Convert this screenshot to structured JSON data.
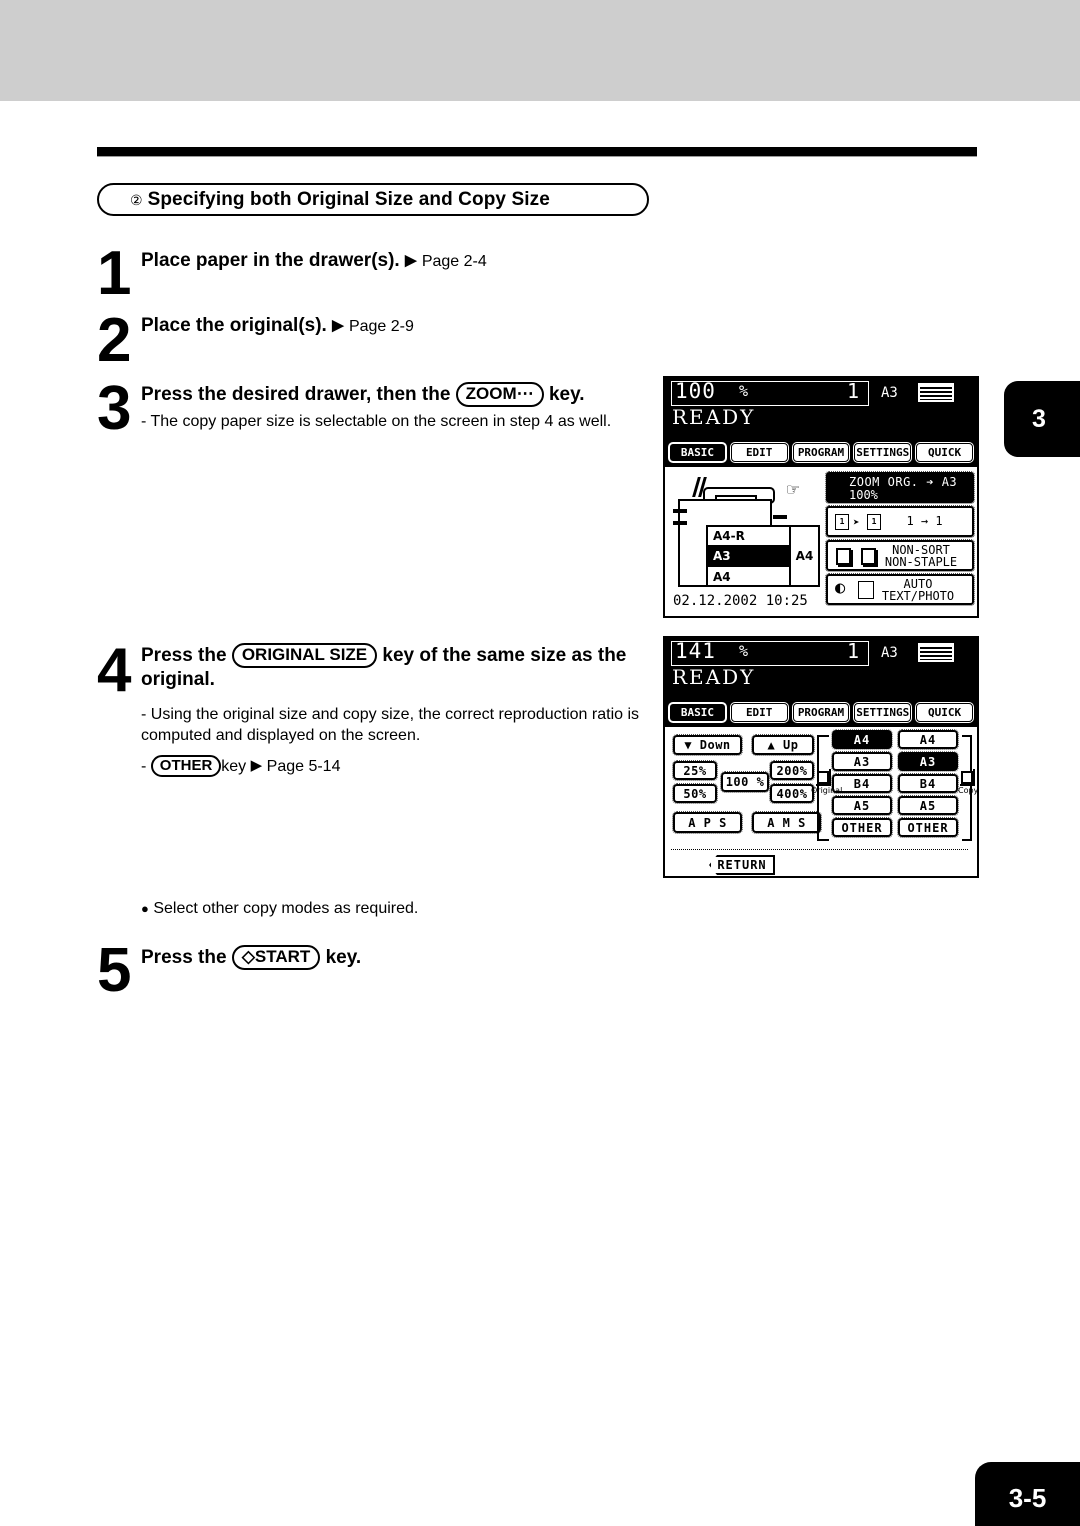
{
  "page": {
    "number": "3-5",
    "chapter_tab": "3"
  },
  "section": {
    "circled_number": "②",
    "title": "Specifying both Original Size and Copy Size"
  },
  "steps": [
    {
      "num": "1",
      "text": "Place paper in the drawer(s).",
      "arrow": "▶",
      "page_ref": "Page 2-4"
    },
    {
      "num": "2",
      "text": "Place the original(s).",
      "arrow": "▶",
      "page_ref": "Page 2-9"
    },
    {
      "num": "3",
      "text_before": "Press the desired drawer, then the",
      "key_label": "ZOOM⋯",
      "text_after": "key.",
      "note": "-  The copy paper size is selectable on the screen in step 4 as well."
    },
    {
      "num": "4",
      "text_before": "Press the",
      "key_label": "ORIGINAL SIZE",
      "text_after": "key of the same size as the original.",
      "note1": "-  Using the original size and copy size, the correct reproduction ratio is computed and displayed on the screen.",
      "note2_dash": "-",
      "note2_key": "OTHER",
      "note2_text": "key",
      "note2_arrow": "▶",
      "note2_ref": "Page 5-14"
    },
    {
      "num": "5",
      "text_before": "Press the",
      "key_label": "START",
      "key_icon": "◇",
      "text_after": "key."
    }
  ],
  "bullet_note": {
    "marker": "●",
    "text": "Select other copy modes as required."
  },
  "lcd1": {
    "ratio": "100",
    "percent": "%",
    "copy_count": "1",
    "paper_size": "A3",
    "status": "READY",
    "tabs": [
      {
        "label": "BASIC",
        "active": true
      },
      {
        "label": "EDIT",
        "active": false
      },
      {
        "label": "PROGRAM",
        "active": false
      },
      {
        "label": "SETTINGS",
        "active": false
      },
      {
        "label": "QUICK",
        "active": false
      }
    ],
    "drawers": [
      {
        "label": "A4-R",
        "selected": false
      },
      {
        "label": "A3",
        "selected": true
      },
      {
        "label": "A4",
        "selected": false
      }
    ],
    "bypass_label": "A4",
    "datetime": "02.12.2002 10:25",
    "buttons": {
      "zoom_l1": "ZOOM   ORG. ➔ A3",
      "zoom_l2": "100%",
      "duplex": "1 → 1",
      "finisher_l1": "NON-SORT",
      "finisher_l2": "NON-STAPLE",
      "mode_l1": "AUTO",
      "mode_l2": "TEXT/PHOTO"
    }
  },
  "lcd2": {
    "ratio": "141",
    "percent": "%",
    "copy_count": "1",
    "paper_size": "A3",
    "status": "READY",
    "tabs": [
      {
        "label": "BASIC",
        "active": true
      },
      {
        "label": "EDIT",
        "active": false
      },
      {
        "label": "PROGRAM",
        "active": false
      },
      {
        "label": "SETTINGS",
        "active": false
      },
      {
        "label": "QUICK",
        "active": false
      }
    ],
    "zoom_controls": {
      "down": "▼ Down",
      "up": "▲ Up",
      "p25": "25%",
      "p50": "50%",
      "p100": "100 %",
      "p200": "200%",
      "p400": "400%",
      "aps": "A P S",
      "ams": "A M S",
      "return": "RETURN"
    },
    "original_label": "Original",
    "copy_label": "Copy",
    "original_sizes": [
      {
        "label": "A4",
        "selected": true
      },
      {
        "label": "A3",
        "selected": false
      },
      {
        "label": "B4",
        "selected": false
      },
      {
        "label": "A5",
        "selected": false
      },
      {
        "label": "OTHER",
        "selected": false
      }
    ],
    "copy_sizes": [
      {
        "label": "A4",
        "selected": false
      },
      {
        "label": "A3",
        "selected": true
      },
      {
        "label": "B4",
        "selected": false
      },
      {
        "label": "A5",
        "selected": false
      },
      {
        "label": "OTHER",
        "selected": false
      }
    ]
  }
}
